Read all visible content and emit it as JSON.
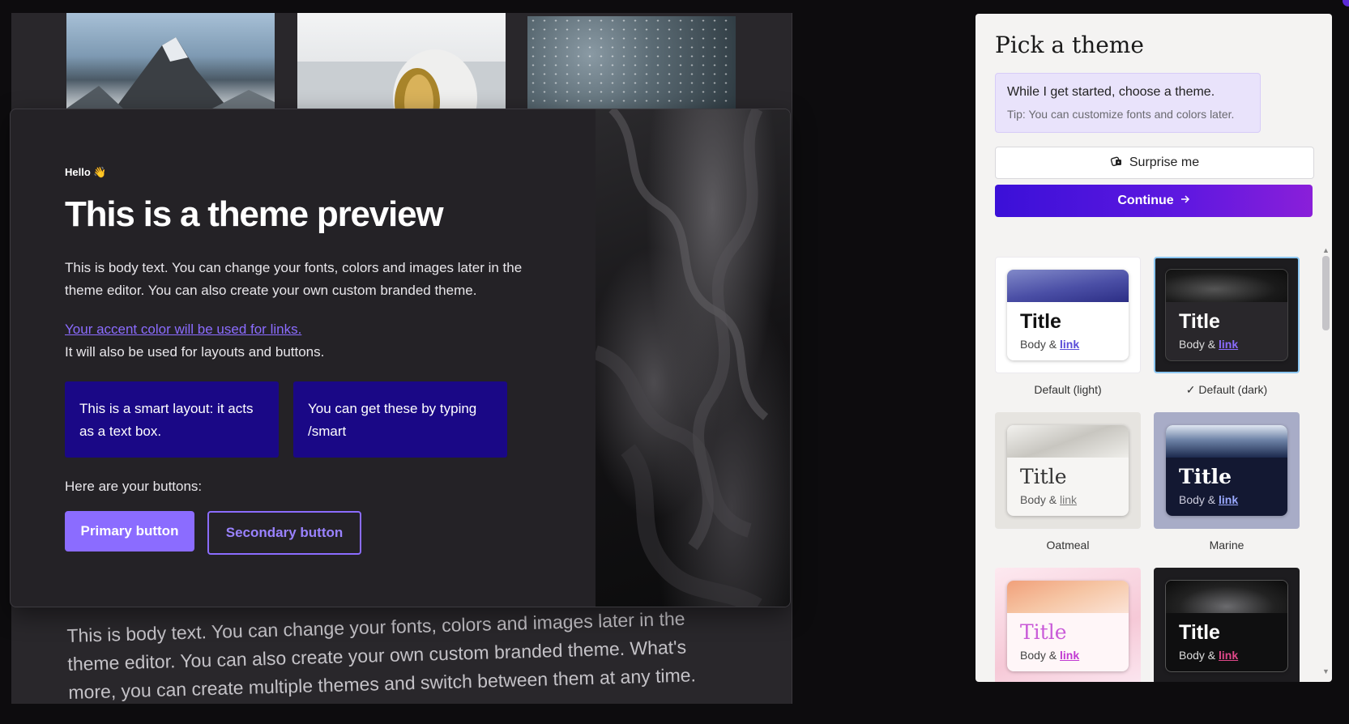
{
  "background": {
    "body_text": "This is body text. You can change your fonts, colors and images later in the theme editor. You can also create your own custom branded theme. What's more, you can create multiple themes and switch between them at any time."
  },
  "preview": {
    "greeting": "Hello 👋",
    "title": "This is a theme preview",
    "body": "This is body text. You can change your fonts, colors and images later in the theme editor. You can also create your own custom branded theme.",
    "accent_link": "Your accent color will be used for links.",
    "accent_note": "It will also be used for layouts and buttons.",
    "smart_boxes": [
      "This is a smart layout: it acts as a text box.",
      "You can get these by typing /smart"
    ],
    "buttons_label": "Here are your buttons:",
    "primary_button": "Primary button",
    "secondary_button": "Secondary button"
  },
  "panel": {
    "title": "Pick a theme",
    "tip_main": "While I get started, choose a theme.",
    "tip_sub": "Tip: You can customize fonts and colors later.",
    "surprise_label": "Surprise me",
    "surprise_icon": "dice-icon",
    "continue_label": "Continue",
    "continue_icon": "arrow-right-icon",
    "themes": [
      {
        "name": "Default (light)",
        "title": "Title",
        "body": "Body &",
        "link": "link",
        "selected": false
      },
      {
        "name": "Default (dark)",
        "title": "Title",
        "body": "Body &",
        "link": "link",
        "selected": true
      },
      {
        "name": "Oatmeal",
        "title": "Title",
        "body": "Body &",
        "link": "link",
        "selected": false
      },
      {
        "name": "Marine",
        "title": "Title",
        "body": "Body &",
        "link": "link",
        "selected": false
      },
      {
        "name": "",
        "title": "Title",
        "body": "Body &",
        "link": "link",
        "selected": false
      },
      {
        "name": "",
        "title": "Title",
        "body": "Body &",
        "link": "link",
        "selected": false
      }
    ],
    "selected_mark": "✓"
  },
  "colors": {
    "accent": "#8b6cff",
    "smart_box": "#1a0886",
    "continue_start": "#3b10d8",
    "continue_end": "#8a1fd9",
    "selected_border": "#8cc7f2"
  }
}
